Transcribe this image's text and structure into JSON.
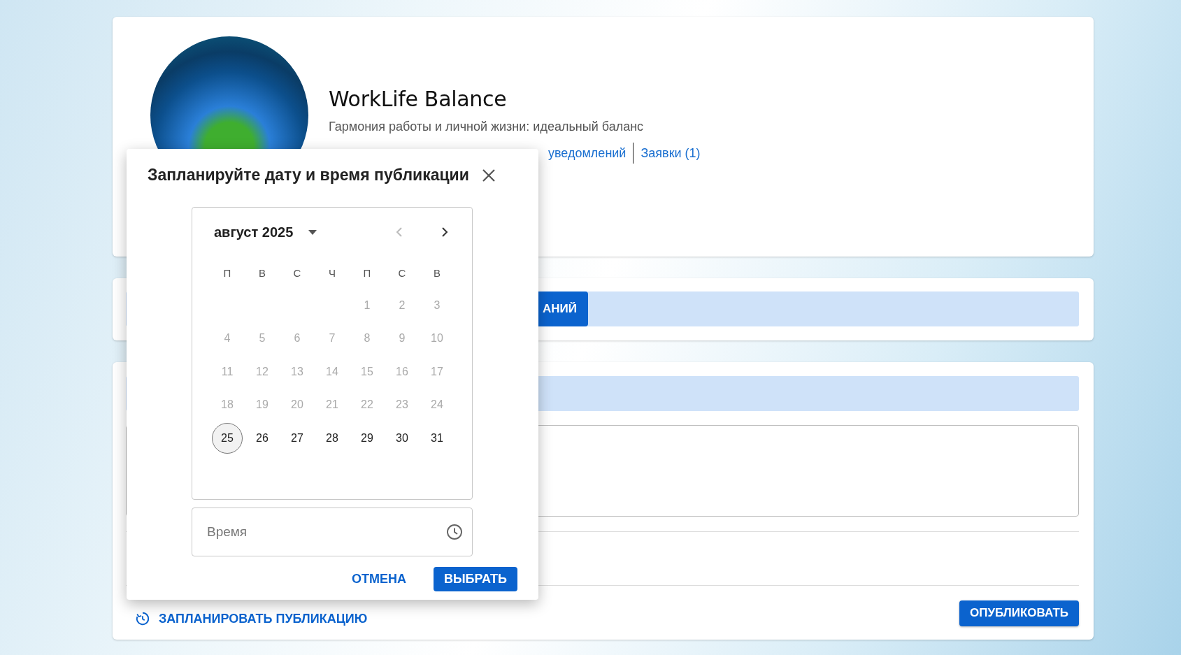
{
  "group": {
    "title": "WorkLife Balance",
    "description": "Гармония работы и личной жизни: идеальный баланс",
    "links": [
      {
        "label": "уведомлений"
      },
      {
        "label": "Заявки (1)"
      }
    ]
  },
  "toolbar": {
    "button": "АНИЙ"
  },
  "composer": {
    "schedule_link": "ЗАПЛАНИРОВАТЬ ПУБЛИКАЦИЮ",
    "publish_button": "ОПУБЛИКОВАТЬ"
  },
  "dialog": {
    "title": "Запланируйте дату и время публикации",
    "calendar": {
      "month_label": "август 2025",
      "prev_disabled": true,
      "next_disabled": false,
      "weekdays": [
        "П",
        "В",
        "С",
        "Ч",
        "П",
        "С",
        "В"
      ],
      "weeks": [
        [
          {
            "label": "1",
            "disabled": true,
            "selected": false
          },
          {
            "label": "2",
            "disabled": true,
            "selected": false
          },
          {
            "label": "3",
            "disabled": true,
            "selected": false
          }
        ],
        [
          {
            "label": "4",
            "disabled": true,
            "selected": false
          },
          {
            "label": "5",
            "disabled": true,
            "selected": false
          },
          {
            "label": "6",
            "disabled": true,
            "selected": false
          },
          {
            "label": "7",
            "disabled": true,
            "selected": false
          },
          {
            "label": "8",
            "disabled": true,
            "selected": false
          },
          {
            "label": "9",
            "disabled": true,
            "selected": false
          },
          {
            "label": "10",
            "disabled": true,
            "selected": false
          }
        ],
        [
          {
            "label": "11",
            "disabled": true,
            "selected": false
          },
          {
            "label": "12",
            "disabled": true,
            "selected": false
          },
          {
            "label": "13",
            "disabled": true,
            "selected": false
          },
          {
            "label": "14",
            "disabled": true,
            "selected": false
          },
          {
            "label": "15",
            "disabled": true,
            "selected": false
          },
          {
            "label": "16",
            "disabled": true,
            "selected": false
          },
          {
            "label": "17",
            "disabled": true,
            "selected": false
          }
        ],
        [
          {
            "label": "18",
            "disabled": true,
            "selected": false
          },
          {
            "label": "19",
            "disabled": true,
            "selected": false
          },
          {
            "label": "20",
            "disabled": true,
            "selected": false
          },
          {
            "label": "21",
            "disabled": true,
            "selected": false
          },
          {
            "label": "22",
            "disabled": true,
            "selected": false
          },
          {
            "label": "23",
            "disabled": true,
            "selected": false
          },
          {
            "label": "24",
            "disabled": true,
            "selected": false
          }
        ],
        [
          {
            "label": "25",
            "disabled": false,
            "selected": true
          },
          {
            "label": "26",
            "disabled": false,
            "selected": false
          },
          {
            "label": "27",
            "disabled": false,
            "selected": false
          },
          {
            "label": "28",
            "disabled": false,
            "selected": false
          },
          {
            "label": "29",
            "disabled": false,
            "selected": false
          },
          {
            "label": "30",
            "disabled": false,
            "selected": false
          },
          {
            "label": "31",
            "disabled": false,
            "selected": false
          }
        ]
      ]
    },
    "time_field": {
      "placeholder": "Время"
    },
    "buttons": [
      {
        "label": "ОТМЕНА",
        "kind": "text"
      },
      {
        "label": "ВЫБРАТЬ",
        "kind": "primary"
      }
    ]
  }
}
